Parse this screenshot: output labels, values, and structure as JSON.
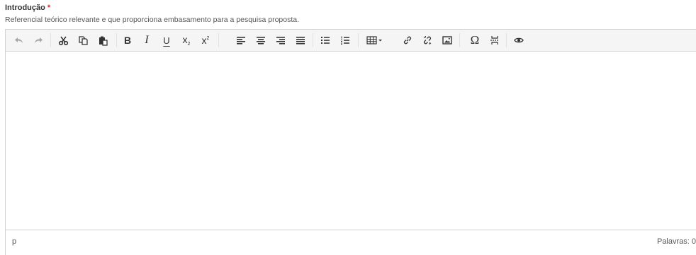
{
  "field": {
    "label": "Introdução",
    "required_mark": "*",
    "help_text": "Referencial teórico relevante e que proporciona embasamento para a pesquisa proposta."
  },
  "toolbar": {
    "buttons": [
      {
        "name": "undo",
        "icon": "undo-icon",
        "enabled": false
      },
      {
        "name": "redo",
        "icon": "redo-icon",
        "enabled": false
      },
      {
        "name": "cut",
        "icon": "scissors-icon",
        "enabled": true
      },
      {
        "name": "copy",
        "icon": "copy-icon",
        "enabled": true
      },
      {
        "name": "paste",
        "icon": "clipboard-icon",
        "enabled": true
      },
      {
        "name": "bold",
        "icon": "bold-icon",
        "enabled": true,
        "text": "B"
      },
      {
        "name": "italic",
        "icon": "italic-icon",
        "enabled": true,
        "text": "I"
      },
      {
        "name": "underline",
        "icon": "underline-icon",
        "enabled": true,
        "text": "U"
      },
      {
        "name": "subscript",
        "icon": "subscript-icon",
        "enabled": true,
        "text": "x"
      },
      {
        "name": "superscript",
        "icon": "superscript-icon",
        "enabled": true,
        "text": "x"
      },
      {
        "name": "align-left",
        "icon": "align-left-icon",
        "enabled": true
      },
      {
        "name": "align-center",
        "icon": "align-center-icon",
        "enabled": true
      },
      {
        "name": "align-right",
        "icon": "align-right-icon",
        "enabled": true
      },
      {
        "name": "align-justify",
        "icon": "align-justify-icon",
        "enabled": true
      },
      {
        "name": "bullet-list",
        "icon": "bullet-list-icon",
        "enabled": true
      },
      {
        "name": "numbered-list",
        "icon": "numbered-list-icon",
        "enabled": true
      },
      {
        "name": "table",
        "icon": "table-icon",
        "enabled": true
      },
      {
        "name": "link",
        "icon": "link-icon",
        "enabled": true
      },
      {
        "name": "unlink",
        "icon": "unlink-icon",
        "enabled": true
      },
      {
        "name": "image",
        "icon": "image-icon",
        "enabled": true
      },
      {
        "name": "special-char",
        "icon": "omega-icon",
        "enabled": true,
        "text": "Ω"
      },
      {
        "name": "page-break",
        "icon": "page-break-icon",
        "enabled": true
      },
      {
        "name": "preview",
        "icon": "eye-icon",
        "enabled": true
      }
    ]
  },
  "editor": {
    "content": ""
  },
  "statusbar": {
    "path": "p",
    "word_count": "Palavras: 0"
  }
}
